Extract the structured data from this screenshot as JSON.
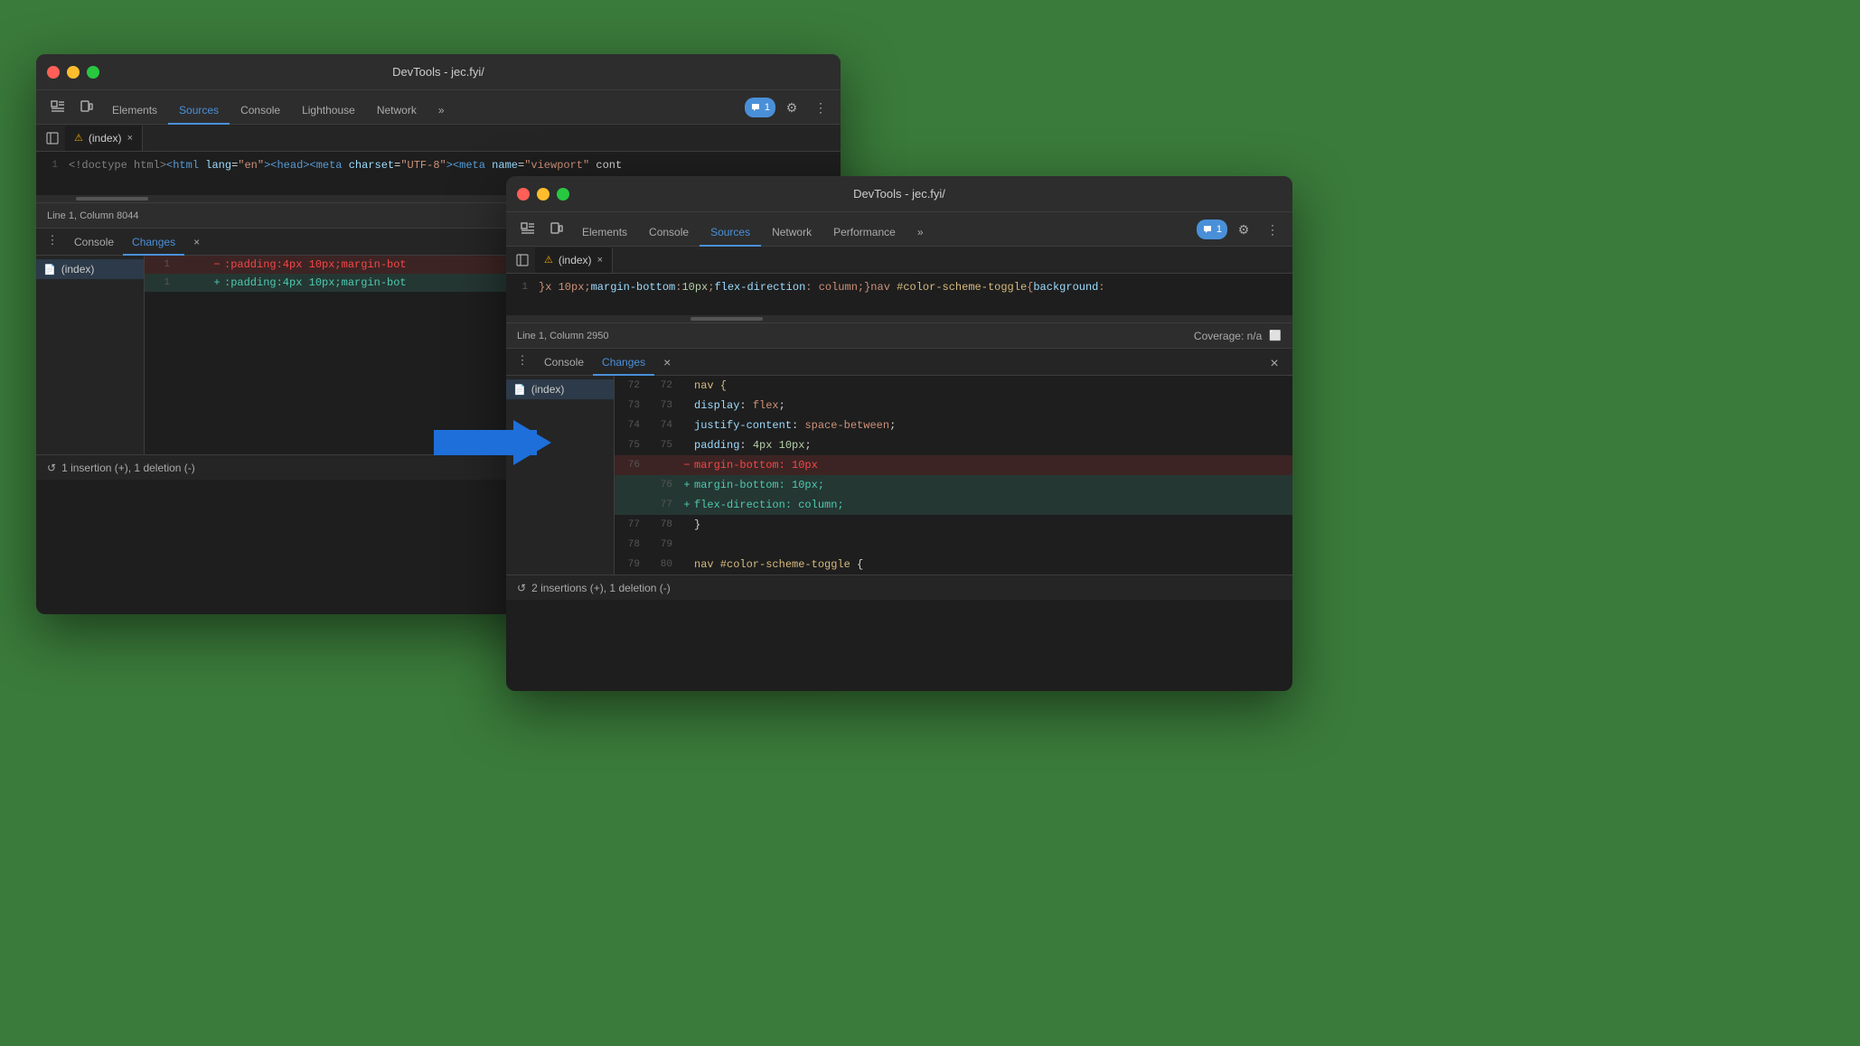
{
  "background_color": "#3a7a3a",
  "window1": {
    "title": "DevTools - jec.fyi/",
    "tabs": [
      "Elements",
      "Sources",
      "Console",
      "Lighthouse",
      "Network"
    ],
    "active_tab": "Sources",
    "more_tabs": "»",
    "file_tab": "(index)",
    "code_line1": "<!doctype html><html lang=\"en\"><head><meta charset=\"UTF-8\"><meta name=\"viewport\" cont",
    "status": "Line 1, Column 8044",
    "drawer": {
      "tabs": [
        "Console",
        "Changes"
      ],
      "active_tab": "Changes",
      "file": "(index)",
      "diff_lines": [
        {
          "num": "1",
          "marker": "-",
          "text": " :padding:4px 10px;margin-bot"
        },
        {
          "num": "1",
          "marker": "+",
          "text": " :padding:4px 10px;margin-bot"
        }
      ],
      "summary": "1 insertion (+), 1 deletion (-)"
    }
  },
  "window2": {
    "title": "DevTools - jec.fyi/",
    "tabs": [
      "Elements",
      "Console",
      "Sources",
      "Network",
      "Performance"
    ],
    "active_tab": "Sources",
    "more_tabs": "»",
    "file_tab": "(index)",
    "code_line1": "}x 10px;margin-bottom:10px;flex-direction: column;}nav #color-scheme-toggle{background:",
    "code_content": {
      "lines": [
        {
          "old": "72",
          "new": "72",
          "marker": " ",
          "text": "            nav {"
        },
        {
          "old": "73",
          "new": "73",
          "marker": " ",
          "text": "                display: flex;"
        },
        {
          "old": "74",
          "new": "74",
          "marker": " ",
          "text": "                justify-content: space-between;"
        },
        {
          "old": "75",
          "new": "75",
          "marker": " ",
          "text": "                padding: 4px 10px;"
        },
        {
          "old": "76",
          "new": "",
          "marker": "-",
          "text": "                margin-bottom: 10px"
        },
        {
          "old": "",
          "new": "76",
          "marker": "+",
          "text": "                margin-bottom: 10px;"
        },
        {
          "old": "",
          "new": "77",
          "marker": "+",
          "text": "                flex-direction: column;"
        },
        {
          "old": "77",
          "new": "78",
          "marker": " ",
          "text": "            }"
        },
        {
          "old": "78",
          "new": "79",
          "marker": " ",
          "text": ""
        },
        {
          "old": "79",
          "new": "80",
          "marker": " ",
          "text": "            nav #color-scheme-toggle {"
        }
      ]
    },
    "status": "Line 1, Column 2950",
    "coverage": "Coverage: n/a",
    "drawer": {
      "tabs": [
        "Console",
        "Changes"
      ],
      "active_tab": "Changes",
      "file": "(index)",
      "summary": "2 insertions (+), 1 deletion (-)"
    }
  },
  "arrow": {
    "color": "#1e6fd9"
  },
  "chat_badge": "1",
  "settings_label": "⚙",
  "more_label": "⋮"
}
